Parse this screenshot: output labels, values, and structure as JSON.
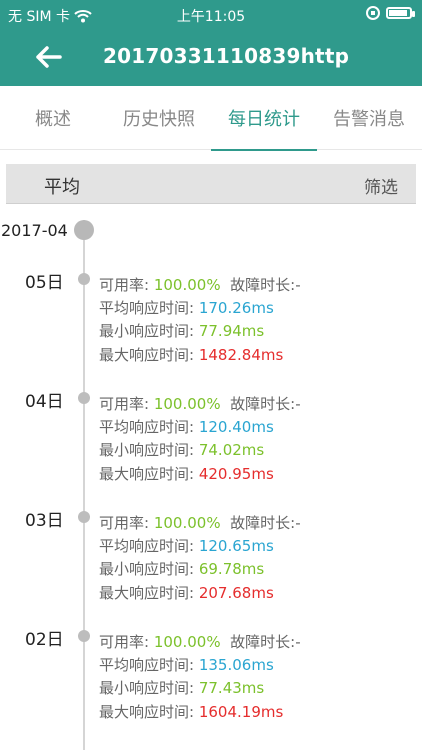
{
  "status_bar": {
    "carrier": "无 SIM 卡",
    "time": "上午11:05",
    "icons": {
      "wifi": "wifi-icon",
      "rotation_lock": "rotation-lock-icon",
      "battery": "battery-icon"
    }
  },
  "nav": {
    "title": "20170331110839http",
    "back_icon": "back-arrow-icon"
  },
  "tabs": [
    {
      "label": "概述"
    },
    {
      "label": "历史快照"
    },
    {
      "label": "每日统计"
    },
    {
      "label": "告警消息"
    }
  ],
  "filter_bar": {
    "left_label": "平均",
    "right_label": "筛选"
  },
  "timeline": {
    "month": "2017-04",
    "entries": [
      {
        "day": "05日",
        "availability_label": "可用率:",
        "availability_value": "100.00%",
        "fault_label": "故障时长:",
        "fault_value": "-",
        "avg_label": "平均响应时间:",
        "avg_value": "170.26ms",
        "min_label": "最小响应时间:",
        "min_value": "77.94ms",
        "max_label": "最大响应时间:",
        "max_value": "1482.84ms"
      },
      {
        "day": "04日",
        "availability_label": "可用率:",
        "availability_value": "100.00%",
        "fault_label": "故障时长:",
        "fault_value": "-",
        "avg_label": "平均响应时间:",
        "avg_value": "120.40ms",
        "min_label": "最小响应时间:",
        "min_value": "74.02ms",
        "max_label": "最大响应时间:",
        "max_value": "420.95ms"
      },
      {
        "day": "03日",
        "availability_label": "可用率:",
        "availability_value": "100.00%",
        "fault_label": "故障时长:",
        "fault_value": "-",
        "avg_label": "平均响应时间:",
        "avg_value": "120.65ms",
        "min_label": "最小响应时间:",
        "min_value": "69.78ms",
        "max_label": "最大响应时间:",
        "max_value": "207.68ms"
      },
      {
        "day": "02日",
        "availability_label": "可用率:",
        "availability_value": "100.00%",
        "fault_label": "故障时长:",
        "fault_value": "-",
        "avg_label": "平均响应时间:",
        "avg_value": "135.06ms",
        "min_label": "最小响应时间:",
        "min_value": "77.43ms",
        "max_label": "最大响应时间:",
        "max_value": "1604.19ms"
      }
    ]
  }
}
